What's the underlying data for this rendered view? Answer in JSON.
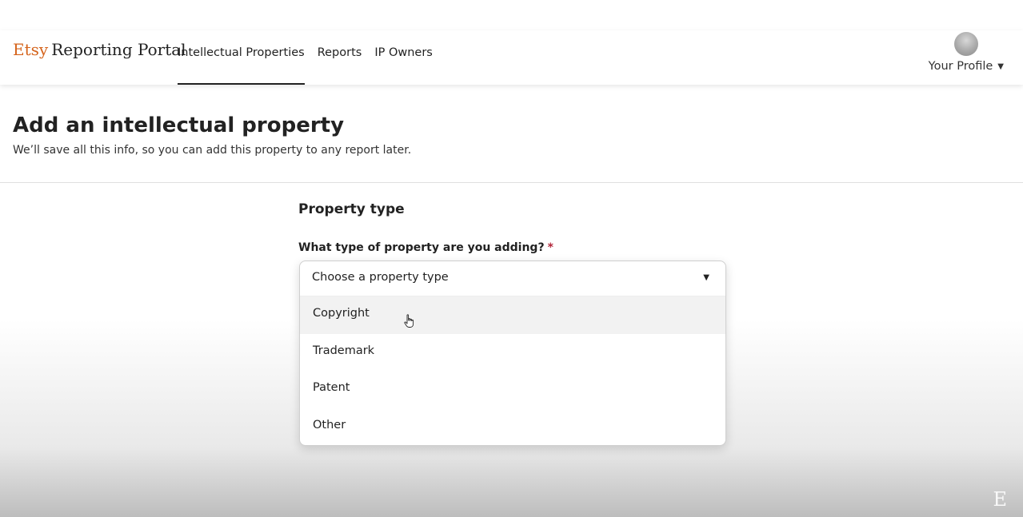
{
  "header": {
    "brand_etsy": "Etsy",
    "brand_portal": "Reporting Portal",
    "nav": [
      {
        "label": "Intellectual Properties",
        "active": true
      },
      {
        "label": "Reports",
        "active": false
      },
      {
        "label": "IP Owners",
        "active": false
      }
    ],
    "profile_label": "Your Profile",
    "profile_caret": "▼"
  },
  "page": {
    "title": "Add an intellectual property",
    "subtitle": "We’ll save all this info, so you can add this property to any report later."
  },
  "form": {
    "section_title": "Property type",
    "field_label": "What type of property are you adding?",
    "required_mark": "*",
    "select": {
      "placeholder": "Choose a property type",
      "caret": "▼",
      "options": [
        "Copyright",
        "Trademark",
        "Patent",
        "Other"
      ],
      "hovered_option": "Copyright"
    }
  },
  "watermark": "E",
  "colors": {
    "brand_accent": "#d5641c",
    "required": "#b2263a",
    "hover_bg": "#f2f2f2"
  },
  "icons": {
    "avatar": "profile-avatar",
    "cursor": "hand-pointer-icon"
  }
}
